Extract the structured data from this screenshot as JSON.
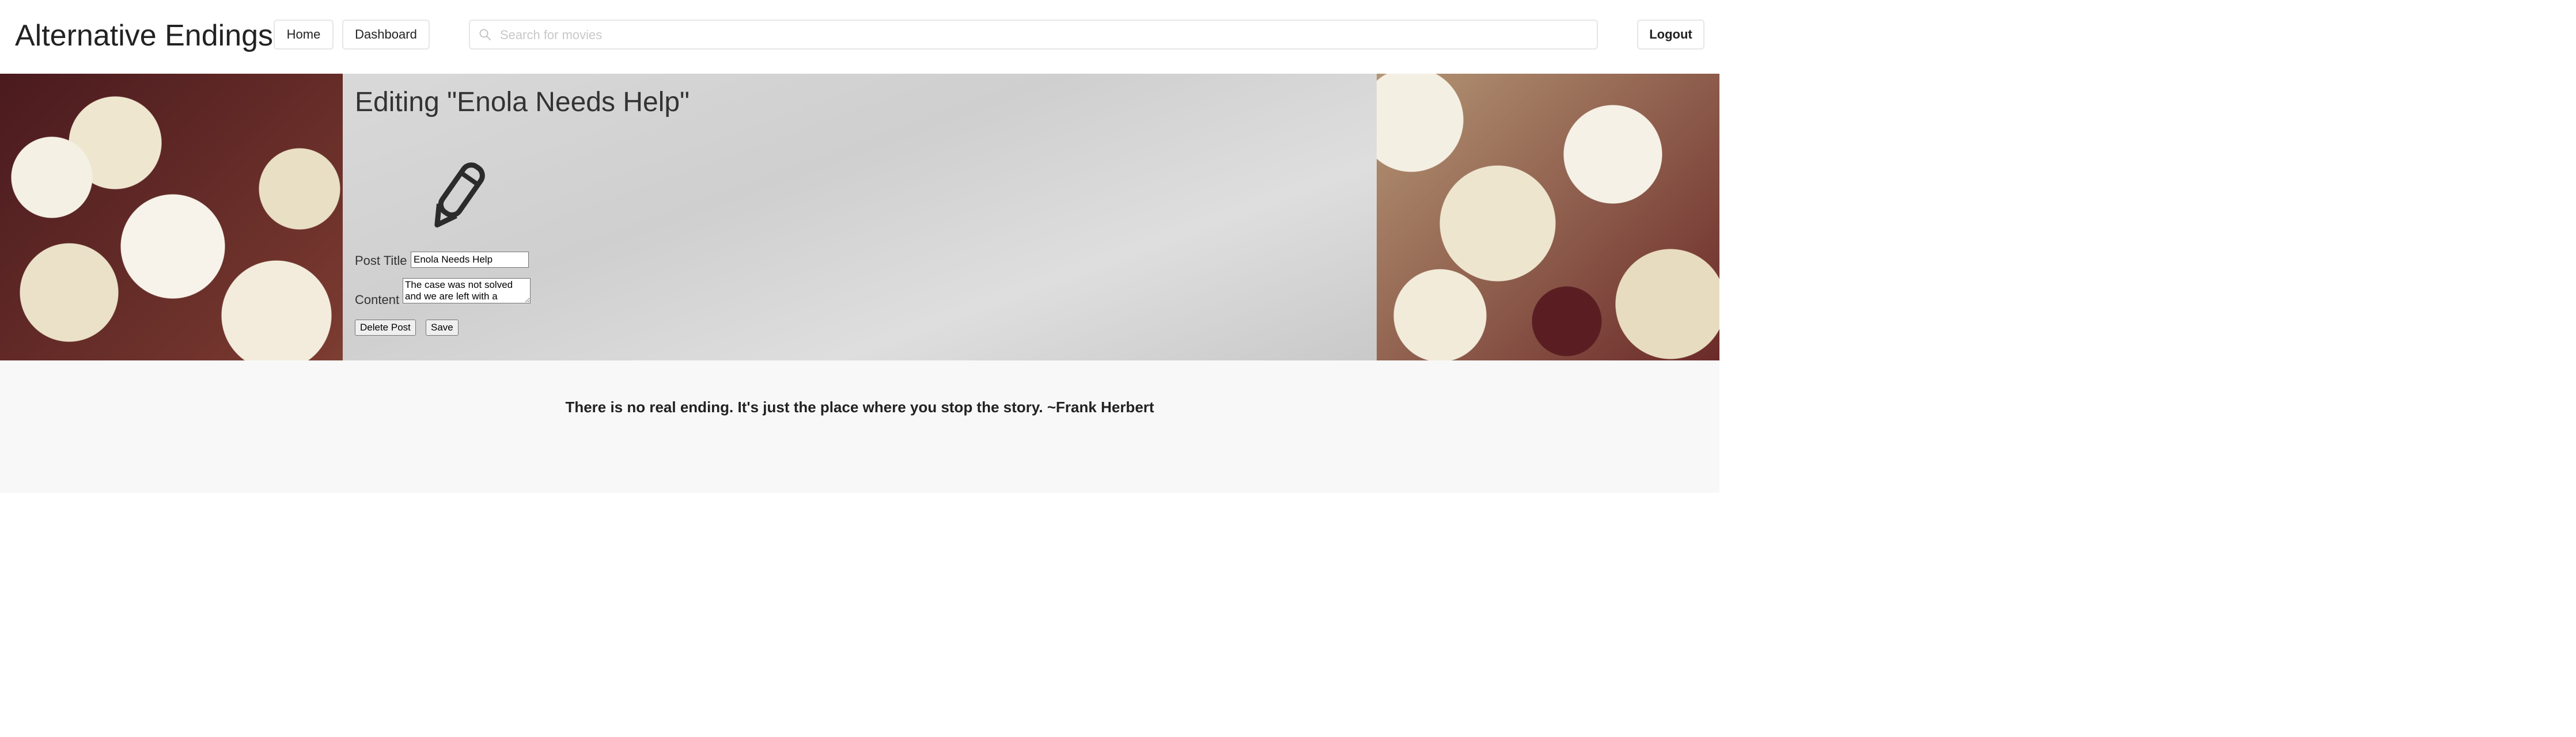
{
  "header": {
    "brand": "Alternative Endings",
    "nav": {
      "home_label": "Home",
      "dashboard_label": "Dashboard",
      "logout_label": "Logout"
    },
    "search": {
      "placeholder": "Search for movies",
      "value": "",
      "icon": "search-icon"
    }
  },
  "edit_form": {
    "heading": "Editing \"Enola Needs Help\"",
    "icon": "pencil-icon",
    "post_title_label": "Post Title",
    "post_title_value": "Enola Needs Help",
    "content_label": "Content",
    "content_value": "The case was not solved and we are left with a cliffhanger",
    "delete_label": "Delete Post",
    "save_label": "Save"
  },
  "footer": {
    "quote": "There is no real ending. It's just the place where you stop the story. ~Frank Herbert"
  },
  "colors": {
    "panel": "#d9d9d9",
    "footer_bg": "#f8f8f8",
    "text": "#222222"
  }
}
